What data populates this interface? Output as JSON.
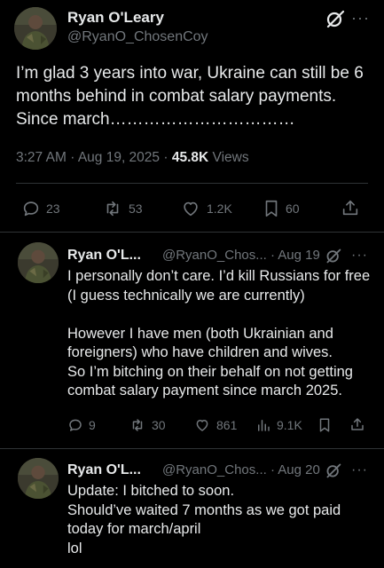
{
  "main_tweet": {
    "name": "Ryan O'Leary",
    "handle": "@RyanO_ChosenCoy",
    "text": "I’m glad 3 years into war, Ukraine can still be 6 months behind in combat salary payments. Since march……………………………",
    "time": "3:27 AM",
    "date": "Aug 19, 2025",
    "views_count": "45.8K",
    "views_label": "Views",
    "replies": "23",
    "reposts": "53",
    "likes": "1.2K",
    "bookmarks": "60"
  },
  "replies": [
    {
      "name": "Ryan O'L...",
      "handle": "@RyanO_Chos...",
      "date": "Aug 19",
      "text": "I personally don’t care. I’d kill Russians for free (I guess technically we are currently)\n\nHowever I have men (both Ukrainian and foreigners) who have children and wives.\nSo I’m bitching on their behalf on not getting combat salary payment since march 2025.",
      "replies": "9",
      "reposts": "30",
      "likes": "861",
      "views": "9.1K"
    },
    {
      "name": "Ryan O'L...",
      "handle": "@RyanO_Chos...",
      "date": "Aug 20",
      "text": "Update: I bitched to soon.\nShould’ve waited 7 months as we got paid today for march/april\nlol"
    }
  ],
  "separator": "·",
  "colors": {
    "background": "#000000",
    "text": "#e7e9ea",
    "secondary": "#71767b",
    "divider": "#2f3336"
  }
}
